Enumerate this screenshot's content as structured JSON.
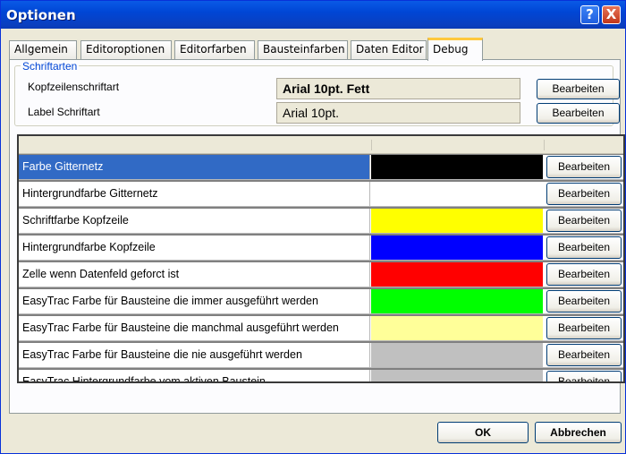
{
  "window": {
    "title": "Optionen",
    "help_symbol": "?",
    "close_symbol": "X"
  },
  "tabs": [
    {
      "label": "Allgemein",
      "active": false
    },
    {
      "label": "Editoroptionen",
      "active": false
    },
    {
      "label": "Editorfarben",
      "active": false
    },
    {
      "label": "Bausteinfarben",
      "active": false
    },
    {
      "label": "Daten Editor",
      "active": false
    },
    {
      "label": "Debug",
      "active": true
    }
  ],
  "fonts_group": {
    "title": "Schriftarten",
    "rows": [
      {
        "label": "Kopfzeilenschriftart",
        "value": "Arial 10pt. Fett",
        "bold": true,
        "button": "Bearbeiten"
      },
      {
        "label": "Label Schriftart",
        "value": "Arial 10pt.",
        "bold": false,
        "button": "Bearbeiten"
      }
    ]
  },
  "color_grid": {
    "rows": [
      {
        "name": "Farbe Gitternetz",
        "color": "#000000",
        "button": "Bearbeiten",
        "selected": true
      },
      {
        "name": "Hintergrundfarbe Gitternetz",
        "color": "#ffffff",
        "button": "Bearbeiten",
        "selected": false
      },
      {
        "name": "Schriftfarbe Kopfzeile",
        "color": "#ffff00",
        "button": "Bearbeiten",
        "selected": false
      },
      {
        "name": "Hintergrundfarbe Kopfzeile",
        "color": "#0000ff",
        "button": "Bearbeiten",
        "selected": false
      },
      {
        "name": "Zelle wenn Datenfeld geforct ist",
        "color": "#ff0000",
        "button": "Bearbeiten",
        "selected": false
      },
      {
        "name": "EasyTrac Farbe für Bausteine die immer ausgeführt werden",
        "color": "#00ff00",
        "button": "Bearbeiten",
        "selected": false
      },
      {
        "name": "EasyTrac Farbe für Bausteine die manchmal ausgeführt werden",
        "color": "#ffff99",
        "button": "Bearbeiten",
        "selected": false
      },
      {
        "name": "EasyTrac Farbe für Bausteine die nie ausgeführt werden",
        "color": "#c0c0c0",
        "button": "Bearbeiten",
        "selected": false
      },
      {
        "name": "EasyTrac Hintergrundfarbe vom aktiven Baustein",
        "color": "#c0c0c0",
        "button": "Bearbeiten",
        "selected": false
      }
    ]
  },
  "footer": {
    "ok_label": "OK",
    "cancel_label": "Abbrechen"
  }
}
